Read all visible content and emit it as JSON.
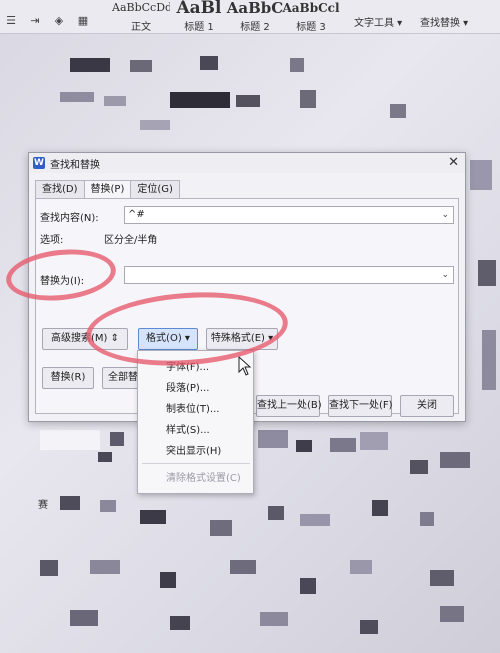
{
  "ribbon": {
    "styles": [
      {
        "preview": "AaBbCcDd",
        "label": "正文"
      },
      {
        "preview": "AaBl",
        "label": "标题 1"
      },
      {
        "preview": "AaBbC",
        "label": "标题 2"
      },
      {
        "preview": "AaBbCcl",
        "label": "标题 3"
      }
    ],
    "text_tools": "文字工具",
    "find_replace": "查找替换"
  },
  "dialog": {
    "title": "查找和替换",
    "tabs": [
      "查找(D)",
      "替换(P)",
      "定位(G)"
    ],
    "active_tab": "替换(P)",
    "find_label": "查找内容(N):",
    "find_value": "^#",
    "options_label": "选项:",
    "options_value": "区分全/半角",
    "replace_label": "替换为(I):",
    "replace_value": "",
    "advanced_search": "高级搜索(M)",
    "format_button": "格式(O)",
    "special_format": "特殊格式(E)",
    "replace_button": "替换(R)",
    "replace_all_button": "全部替",
    "find_prev": "查找上一处(B)",
    "find_next": "查找下一处(F)",
    "close": "关闭"
  },
  "format_menu": {
    "items": [
      "字体(F)...",
      "段落(P)...",
      "制表位(T)...",
      "样式(S)...",
      "突出显示(H)"
    ],
    "clear_item": "清除格式设置(C)"
  },
  "doc_fragment": "赛"
}
